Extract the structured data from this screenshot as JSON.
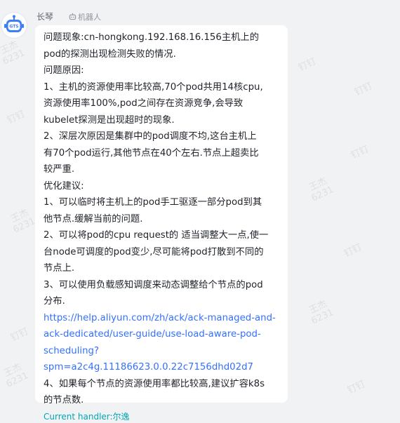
{
  "sender": {
    "name": "长琴",
    "bot_tag": "机器人",
    "avatar_text": "GTS"
  },
  "message": {
    "lines": [
      "问题现象:cn-hongkong.192.168.16.156主机上的",
      "pod的探测出现检测失败的情况.",
      "问题原因:",
      "1、主机的资源使用率比较高,70个pod共用14核cpu,",
      "资源使用率100%,pod之间存在资源竞争,会导致",
      "kubelet探测是出现超时的现象.",
      "2、深层次原因是集群中的pod调度不均,这台主机上",
      "有70个pod运行,其他节点在40个左右.节点上超卖比",
      "较严重.",
      "优化建议:",
      "1、可以临时将主机上的pod手工驱逐一部分pod到其",
      "他节点.缓解当前的问题.",
      "2、可以将pod的cpu request的 适当调整大一点,使一",
      "台node可调度的pod变少,尽可能将pod打散到不同的",
      "节点上.",
      "3、可以使用负载感知调度来动态调整给个节点的pod",
      "分布."
    ],
    "link_lines": [
      "https://help.aliyun.com/zh/ack/ack-managed-and-",
      "ack-dedicated/user-guide/use-load-aware-pod-",
      "scheduling?",
      "spm=a2c4g.11186623.0.0.22c7156dhd02d7"
    ],
    "tail_lines": [
      "4、如果每个节点的资源使用率都比较高,建议扩容k8s",
      "的节点数."
    ],
    "handler": "Current handler:尔逸"
  },
  "watermark": {
    "name": "王杰",
    "id": "6231",
    "app": "钉钉"
  },
  "colors": {
    "background": "#f1f2f4",
    "bubble": "#ffffff",
    "link": "#3370ff",
    "handler": "#00a7b5",
    "avatar_accent": "#3b7ef7"
  }
}
